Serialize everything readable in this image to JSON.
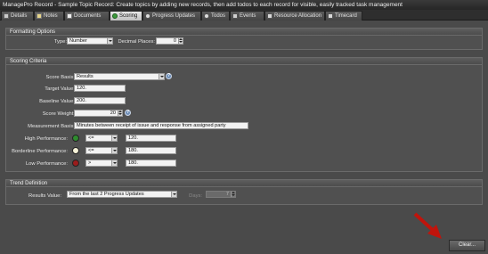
{
  "window": {
    "title": "ManagePro Record - Sample Topic Record:  Create topics by adding new records, then add todos to each record for visible, easily tracked task management"
  },
  "tabs": [
    {
      "label": "Details",
      "icon": "details-icon"
    },
    {
      "label": "Notes",
      "icon": "notes-icon"
    },
    {
      "label": "Documents",
      "icon": "documents-icon"
    },
    {
      "label": "Scoring",
      "icon": "scoring-icon",
      "active": true
    },
    {
      "label": "Progress Updates",
      "icon": "progress-icon"
    },
    {
      "label": "Todos",
      "icon": "todos-icon"
    },
    {
      "label": "Events",
      "icon": "events-icon"
    },
    {
      "label": "Resource Allocation",
      "icon": "resource-icon"
    },
    {
      "label": "Timecard",
      "icon": "timecard-icon"
    }
  ],
  "formatting": {
    "header": "Formatting Options",
    "type_label": "Type:",
    "type_value": "Number",
    "decimal_label": "Decimal Places:",
    "decimal_value": "0"
  },
  "scoring": {
    "header": "Scoring Criteria",
    "score_basis_label": "Score Basis:",
    "score_basis_value": "Results",
    "target_label": "Target Value:",
    "target_value": "120.",
    "baseline_label": "Baseline Value:",
    "baseline_value": "200.",
    "weight_label": "Score Weight:",
    "weight_value": "20",
    "measurement_label": "Measurement Basis:",
    "measurement_value": "Minutes between receipt of issue and response from assigned party",
    "high_label": "High Performance:",
    "high_color": "#2e8b2e",
    "high_op": "<=",
    "high_value": "120.",
    "border_label": "Borderline Performance:",
    "border_color": "#f7f3d9",
    "border_op": "<=",
    "border_value": "180.",
    "low_label": "Low Performance:",
    "low_color": "#9b1c1c",
    "low_op": ">",
    "low_value": "180.",
    "help_glyph": "?"
  },
  "trend": {
    "header": "Trend Definition",
    "results_label": "Results Value:",
    "results_value": "From the last 2 Progress Updates",
    "days_label": "Days:",
    "days_value": "7"
  },
  "footer": {
    "clear_label": "Clear...",
    "arrow_color": "#c0140c"
  }
}
